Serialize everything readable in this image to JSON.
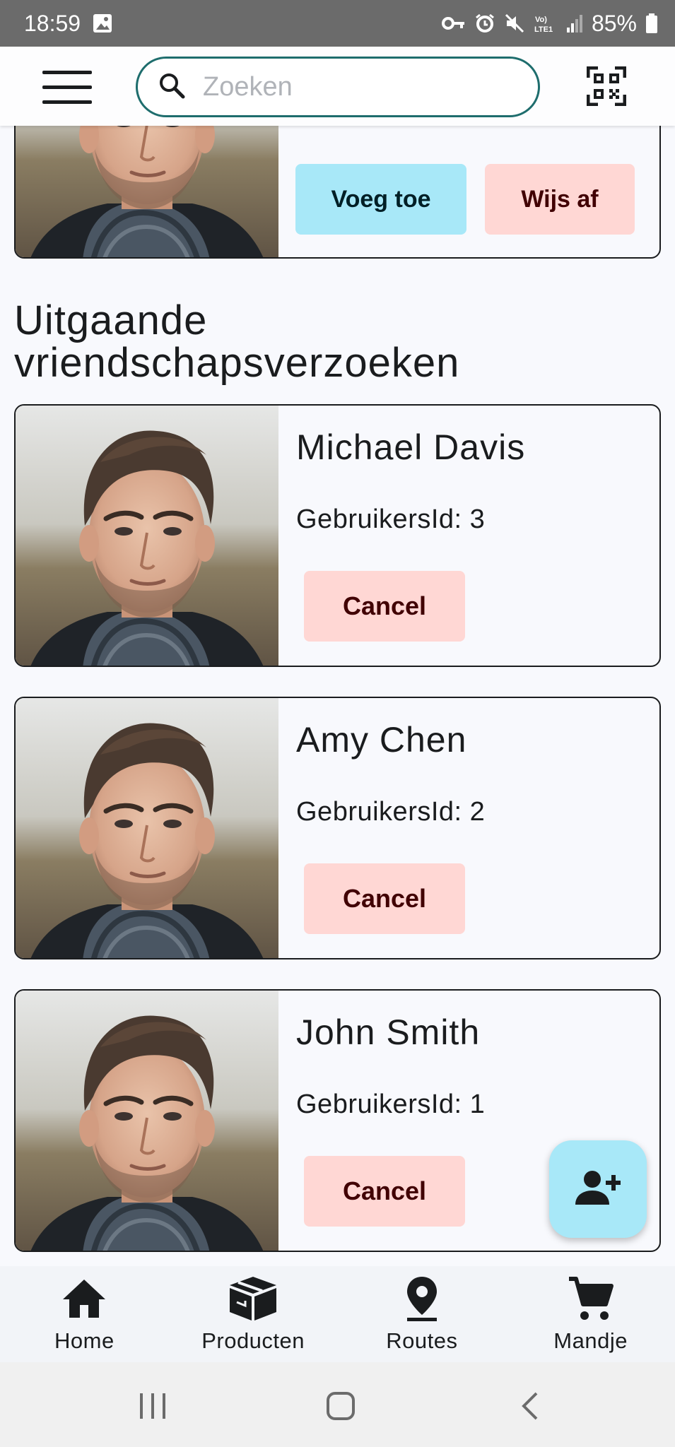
{
  "status_bar": {
    "time": "18:59",
    "battery_percent": "85%"
  },
  "app_bar": {
    "search_placeholder": "Zoeken"
  },
  "incoming_request": {
    "accept_label": "Voeg toe",
    "reject_label": "Wijs af"
  },
  "outgoing": {
    "title": "Uitgaande vriendschapsverzoeken",
    "requests": [
      {
        "name": "Michael Davis",
        "id_text": "GebruikersId: 3",
        "cancel_label": "Cancel"
      },
      {
        "name": "Amy Chen",
        "id_text": "GebruikersId: 2",
        "cancel_label": "Cancel"
      },
      {
        "name": "John Smith",
        "id_text": "GebruikersId: 1",
        "cancel_label": "Cancel"
      }
    ]
  },
  "fab": {
    "icon": "person-add-icon"
  },
  "bottom_nav": {
    "items": [
      {
        "label": "Home",
        "icon": "home-icon"
      },
      {
        "label": "Producten",
        "icon": "box-icon"
      },
      {
        "label": "Routes",
        "icon": "location-pin-icon"
      },
      {
        "label": "Mandje",
        "icon": "cart-icon"
      }
    ]
  },
  "colors": {
    "accent_teal": "#1e6d6d",
    "cancel_bg": "#ffd7d4",
    "accept_bg": "#a8e8f8",
    "background": "#f8f9fd"
  }
}
